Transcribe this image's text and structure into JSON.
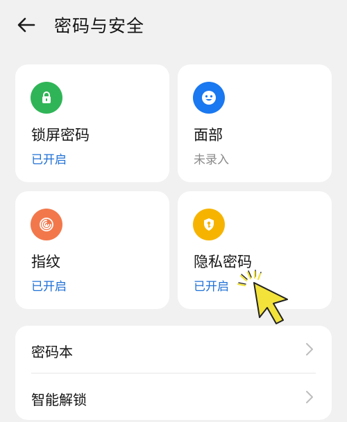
{
  "header": {
    "title": "密码与安全"
  },
  "cards": [
    {
      "name": "锁屏密码",
      "status": "已开启",
      "state": "on",
      "icon": "lock-icon",
      "color": "#2fb557"
    },
    {
      "name": "面部",
      "status": "未录入",
      "state": "off",
      "icon": "face-icon",
      "color": "#1a78f0"
    },
    {
      "name": "指纹",
      "status": "已开启",
      "state": "on",
      "icon": "fingerprint-icon",
      "color": "#f2784b"
    },
    {
      "name": "隐私密码",
      "status": "已开启",
      "state": "on",
      "icon": "shield-key-icon",
      "color": "#f6b400"
    }
  ],
  "list": {
    "items": [
      {
        "label": "密码本"
      },
      {
        "label": "智能解锁"
      }
    ]
  },
  "colors": {
    "accent": "#1d6fd6",
    "background": "#f1f1f1",
    "cursor": "#f2e23a"
  }
}
